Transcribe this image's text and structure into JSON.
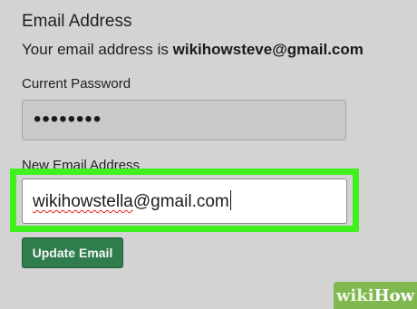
{
  "email_settings": {
    "heading": "Email Address",
    "current_email_prefix": "Your email address is ",
    "current_email": "wikihowsteve@gmail.com",
    "current_password": {
      "label": "Current Password",
      "masked_value": "••••••••"
    },
    "new_email": {
      "label": "New Email Address",
      "username_part": "wikihowstella",
      "domain_part": "@gmail.com"
    },
    "update_button_label": "Update Email"
  },
  "watermark": {
    "prefix": "wiki",
    "suffix": "How"
  },
  "colors": {
    "highlight": "#3ff21f",
    "button": "#2f7d4c",
    "spellcheck_underline": "#e0241b",
    "watermark_bg": "#7fb84f"
  }
}
